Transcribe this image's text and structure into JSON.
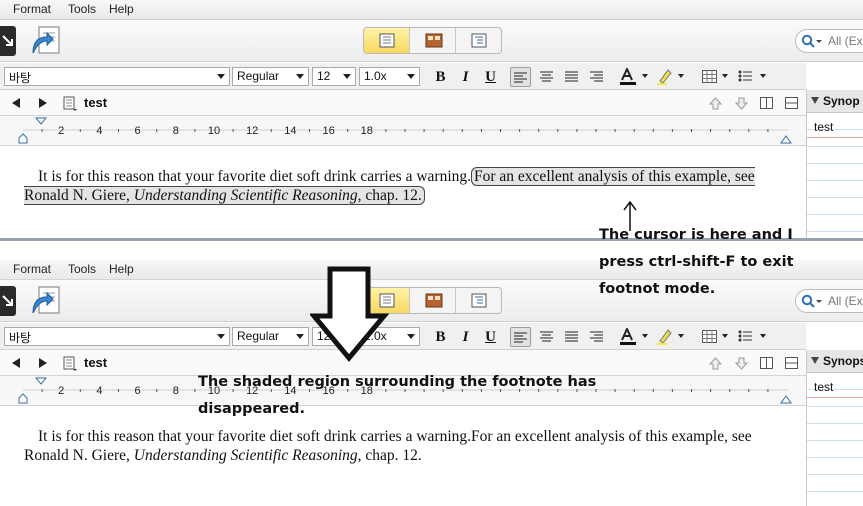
{
  "menus": [
    "Format",
    "Tools",
    "Help"
  ],
  "search_placeholder": "All (Ex",
  "format": {
    "font": "바탕",
    "style": "Regular",
    "size": "12",
    "spacing": "1.0x",
    "bold": "B",
    "italic": "I",
    "underline": "U"
  },
  "document": {
    "title": "test",
    "ruler_ticks": [
      "2",
      "4",
      "6",
      "8",
      "10",
      "12",
      "14",
      "16",
      "18"
    ],
    "body_text": "It is for this reason that your favorite diet soft drink carries a warning.",
    "footnote_text": "For an excellent analysis of this example, see Ronald N. Giere, ",
    "footnote_italic": "Understanding Scientific Reasoning",
    "footnote_tail": ", chap. 12."
  },
  "synopsis": {
    "top_header": "Synop",
    "bottom_header": "Synops",
    "text": "test"
  },
  "annotations": {
    "cursor_note": [
      "The cursor is here and I",
      "press ctrl-shift-F to exit",
      "footnot mode."
    ],
    "shade_note": [
      "The shaded region surrounding the footnote has",
      "disappeared."
    ]
  },
  "colors": {
    "active_view": "#f6d860",
    "footnote_shade": "#e4e4e4",
    "ruler_blue": "#3a6ea5"
  }
}
